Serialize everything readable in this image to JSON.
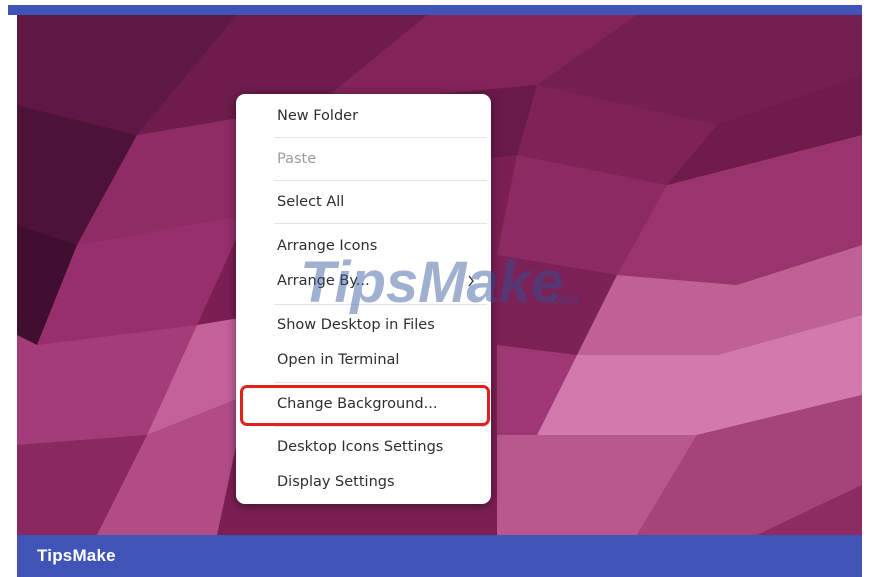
{
  "menu": {
    "items": [
      {
        "label": "New Folder",
        "enabled": true
      },
      {
        "label": "Paste",
        "enabled": false
      },
      {
        "label": "Select All",
        "enabled": true
      },
      {
        "label": "Arrange Icons",
        "enabled": true
      },
      {
        "label": "Arrange By...",
        "enabled": true,
        "submenu_icon": "chevron-right-icon"
      },
      {
        "label": "Show Desktop in Files",
        "enabled": true
      },
      {
        "label": "Open in Terminal",
        "enabled": true
      },
      {
        "label": "Change Background...",
        "enabled": true,
        "highlighted": true
      },
      {
        "label": "Desktop Icons Settings",
        "enabled": true
      },
      {
        "label": "Display Settings",
        "enabled": true
      }
    ]
  },
  "highlight": {
    "color": "#e3201b",
    "target": "Change Background..."
  },
  "watermark": {
    "text_main": "TipsMake",
    "text_suffix": ".com"
  },
  "caption": {
    "text": "TipsMake"
  },
  "colors": {
    "caption_bar": "#4054b8",
    "wallpaper_base": "#7a1f52",
    "wallpaper_accent": "#c05a96",
    "menu_background": "#ffffff"
  }
}
